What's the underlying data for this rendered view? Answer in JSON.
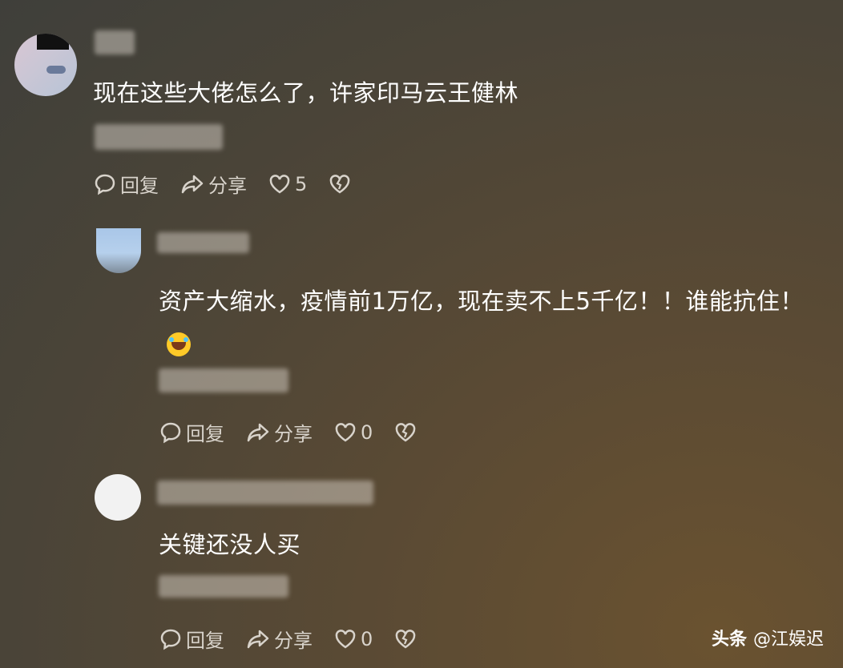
{
  "comments": [
    {
      "text": "现在这些大佬怎么了，许家印马云王健林",
      "reply_label": "回复",
      "share_label": "分享",
      "like_count": "5"
    },
    {
      "text": "资产大缩水，疫情前1万亿，现在卖不上5千亿！！谁能抗住！",
      "reply_label": "回复",
      "share_label": "分享",
      "like_count": "0",
      "emoji": "laughing-with-tears-emoji"
    },
    {
      "text": "关键还没人买",
      "reply_label": "回复",
      "share_label": "分享",
      "like_count": "0"
    }
  ],
  "watermark": {
    "brand": "头条",
    "handle": "@江娱迟"
  }
}
